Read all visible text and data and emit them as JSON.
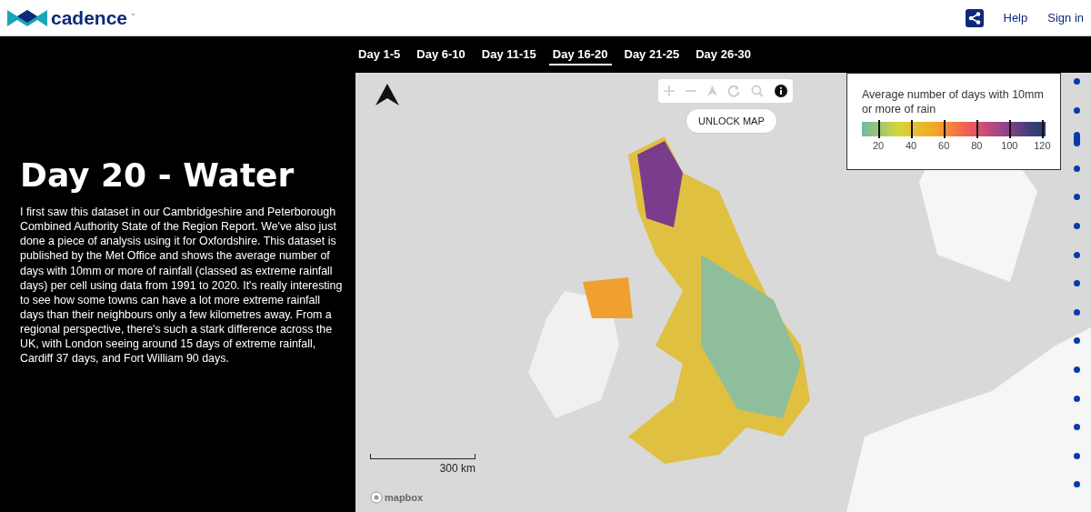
{
  "header": {
    "logo_text": "cadence",
    "logo_mark": "™",
    "links": [
      "Help",
      "Sign in"
    ]
  },
  "tabs": [
    {
      "label": "Day 1-5",
      "selected": false
    },
    {
      "label": "Day 6-10",
      "selected": false
    },
    {
      "label": "Day 11-15",
      "selected": false
    },
    {
      "label": "Day 16-20",
      "selected": true
    },
    {
      "label": "Day 21-25",
      "selected": false
    },
    {
      "label": "Day 26-30",
      "selected": false
    }
  ],
  "story": {
    "title": "Day 20 - Water",
    "body": "I first saw this dataset in our Cambridgeshire and Peterborough Combined Authority State of the Region Report. We've also just done a piece of analysis using it for Oxfordshire. This dataset is published by the Met Office and shows the average number of days with 10mm or more of rainfall (classed as extreme rainfall days) per cell using data from 1991 to 2020. It's really interesting to see how some towns can have a lot more extreme rainfall days than their neighbours only a few kilometres away. From a regional perspective, there's such a stark difference across the UK, with London seeing around 15 days of extreme rainfall, Cardiff 37 days, and Fort William 90 days."
  },
  "map": {
    "unlock_button": "UNLOCK MAP",
    "scale_label": "300 km",
    "attribution": "mapbox",
    "legend": {
      "title": "Average number of days with 10mm or more of rain",
      "ticks": [
        "20",
        "40",
        "60",
        "80",
        "100",
        "120"
      ]
    }
  },
  "pager": [
    {
      "selected": false
    },
    {
      "selected": false
    },
    {
      "selected": true
    },
    {
      "selected": false
    },
    {
      "selected": false
    },
    {
      "selected": false
    },
    {
      "selected": false
    },
    {
      "selected": false
    },
    {
      "selected": false
    },
    {
      "selected": false
    },
    {
      "selected": false
    },
    {
      "selected": false
    },
    {
      "selected": false
    },
    {
      "selected": false
    },
    {
      "selected": false
    }
  ]
}
